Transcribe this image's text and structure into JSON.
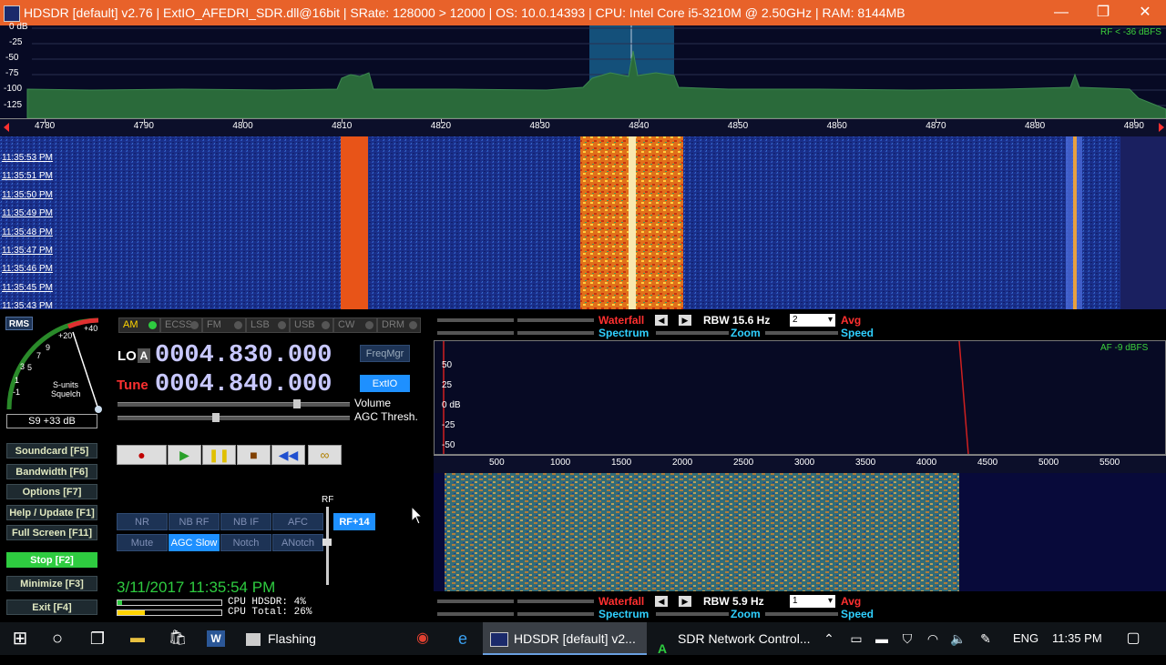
{
  "window": {
    "title": "HDSDR  [default]  v2.76   |  ExtIO_AFEDRI_SDR.dll@16bit   |  SRate: 128000 > 12000   |  OS: 10.0.14393    |  CPU: Intel Core i5-3210M @ 2.50GHz  |  RAM: 8144MB",
    "minimize": "—",
    "maximize": "❐",
    "close": "✕"
  },
  "spectrum": {
    "db_labels": [
      "0 dB",
      "-25",
      "-50",
      "-75",
      "-100",
      "-125"
    ],
    "rf_level": "RF < -36 dBFS",
    "freq_ticks": [
      "4780",
      "4790",
      "4800",
      "4810",
      "4820",
      "4830",
      "4840",
      "4850",
      "4860",
      "4870",
      "4880",
      "4890"
    ]
  },
  "waterfall": {
    "timestamps": [
      "11:35:53 PM",
      "11:35:51 PM",
      "11:35:50 PM",
      "11:35:49 PM",
      "11:35:48 PM",
      "11:35:47 PM",
      "11:35:46 PM",
      "11:35:45 PM",
      "11:35:43 PM"
    ]
  },
  "smeter": {
    "rms": "RMS",
    "scale": [
      "-1",
      "1",
      "3",
      "5",
      "7",
      "9",
      "+20",
      "+40"
    ],
    "caption1": "S-units",
    "caption2": "Squelch",
    "reading": "S9 +33 dB"
  },
  "sidebar": {
    "items": [
      {
        "label": "Soundcard  [F5]"
      },
      {
        "label": "Bandwidth  [F6]"
      },
      {
        "label": "Options    [F7]"
      },
      {
        "label": "Help / Update  [F1]"
      },
      {
        "label": "Full Screen  [F11]"
      },
      {
        "label": "Stop          [F2]"
      },
      {
        "label": "Minimize  [F3]"
      },
      {
        "label": "Exit         [F4]"
      }
    ]
  },
  "modes": [
    "AM",
    "ECSS",
    "FM",
    "LSB",
    "USB",
    "CW",
    "DRM"
  ],
  "tuning": {
    "lo_label": "LO",
    "lo_a": "A",
    "lo_value": "0004.830.000",
    "tune_label": "Tune",
    "tune_value": "0004.840.000",
    "freqmgr": "FreqMgr",
    "extio": "ExtIO",
    "volume": "Volume",
    "agc_thresh": "AGC Thresh.",
    "volume_level": 0.78,
    "agc_level": 0.42
  },
  "transport": [
    "●",
    "▶",
    "❚❚",
    "■",
    "◀◀",
    "∞"
  ],
  "functions": {
    "row1": [
      "NR",
      "NB RF",
      "NB IF",
      "AFC"
    ],
    "row2": [
      "Mute",
      "AGC Slow",
      "Notch",
      "ANotch"
    ],
    "rf_label": "RF",
    "rf_gain": "RF+14"
  },
  "status": {
    "datetime": "3/11/2017 11:35:54 PM",
    "cpu_hdsdr": "CPU HDSDR:  4%",
    "cpu_total": "CPU Total:  26%",
    "cpu_hdsdr_level": 0.04,
    "cpu_total_level": 0.26
  },
  "top_controls": {
    "waterfall": "Waterfall",
    "spectrum": "Spectrum",
    "rbw": "RBW 15.6 Hz",
    "select": "2",
    "avg": "Avg",
    "zoom": "Zoom",
    "speed": "Speed"
  },
  "audio": {
    "af_level": "AF  -9 dBFS",
    "db_labels": [
      "50",
      "25",
      "0 dB",
      "-25",
      "-50"
    ],
    "freq_ticks": [
      "500",
      "1000",
      "1500",
      "2000",
      "2500",
      "3000",
      "3500",
      "4000",
      "4500",
      "5000",
      "5500"
    ]
  },
  "bottom_controls": {
    "waterfall": "Waterfall",
    "spectrum": "Spectrum",
    "rbw": "RBW  5.9 Hz",
    "select": "1",
    "avg": "Avg",
    "zoom": "Zoom",
    "speed": "Speed"
  },
  "taskbar": {
    "flashing": "Flashing",
    "hdsdr": "HDSDR  [default]  v2...",
    "sdrnet": "SDR Network Control...",
    "lang": "ENG",
    "clock": "11:35 PM"
  },
  "colors": {
    "titlebar": "#e8622a",
    "digits": "#c8c8ff",
    "accent_red": "#ff3030",
    "accent_cyan": "#30d0ff",
    "active_green": "#2ecc40",
    "highlight_blue": "#1e90ff"
  }
}
